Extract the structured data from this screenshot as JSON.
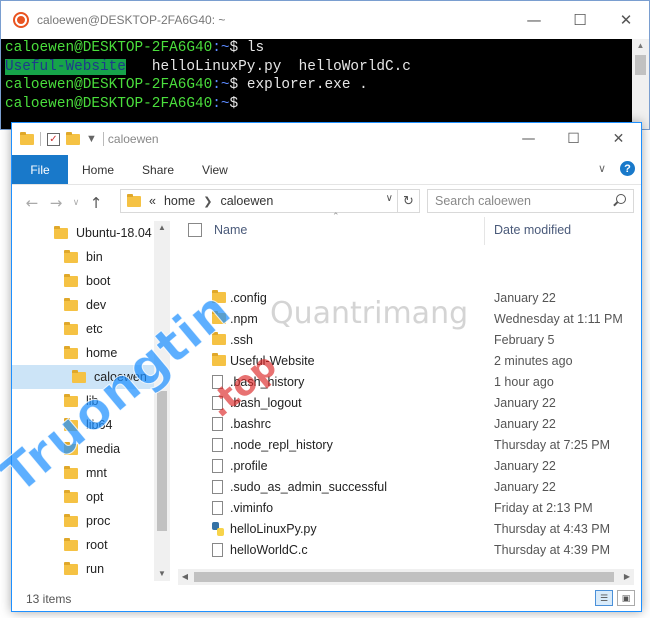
{
  "terminal": {
    "title": "caloewen@DESKTOP-2FA6G40: ~",
    "user_host": "caloewen@DESKTOP-2FA6G40",
    "path": ":~",
    "prompt_char": "$",
    "lines": [
      {
        "cmd": " ls"
      },
      {
        "cmd": " explorer.exe ."
      },
      {
        "cmd": ""
      }
    ],
    "ls_output": {
      "dir": "Useful-Website",
      "files": "   helloLinuxPy.py  helloWorldC.c"
    }
  },
  "explorer": {
    "title": "caloewen",
    "ribbon_tabs": [
      "File",
      "Home",
      "Share",
      "View"
    ],
    "breadcrumb": {
      "lead": "«",
      "items": [
        "home",
        "caloewen"
      ]
    },
    "search_placeholder": "Search caloewen",
    "nav_items": [
      {
        "label": "Ubuntu-18.04"
      },
      {
        "label": "bin"
      },
      {
        "label": "boot"
      },
      {
        "label": "dev"
      },
      {
        "label": "etc"
      },
      {
        "label": "home"
      },
      {
        "label": "caloewen"
      },
      {
        "label": "lib"
      },
      {
        "label": "lib64"
      },
      {
        "label": "media"
      },
      {
        "label": "mnt"
      },
      {
        "label": "opt"
      },
      {
        "label": "proc"
      },
      {
        "label": "root"
      },
      {
        "label": "run"
      }
    ],
    "columns": {
      "name": "Name",
      "date": "Date modified"
    },
    "files": [
      {
        "name": ".config",
        "date": "January 22",
        "icon": "folder-icon"
      },
      {
        "name": ".npm",
        "date": "Wednesday at 1:11 PM",
        "icon": "folder-icon"
      },
      {
        "name": ".ssh",
        "date": "February 5",
        "icon": "folder-icon"
      },
      {
        "name": "Useful-Website",
        "date": "2 minutes ago",
        "icon": "folder-icon"
      },
      {
        "name": ".bash_history",
        "date": "1 hour ago",
        "icon": "file-icon"
      },
      {
        "name": ".bash_logout",
        "date": "January 22",
        "icon": "file-icon"
      },
      {
        "name": ".bashrc",
        "date": "January 22",
        "icon": "file-icon"
      },
      {
        "name": ".node_repl_history",
        "date": "Thursday at 7:25 PM",
        "icon": "file-icon"
      },
      {
        "name": ".profile",
        "date": "January 22",
        "icon": "file-icon"
      },
      {
        "name": ".sudo_as_admin_successful",
        "date": "January 22",
        "icon": "file-icon"
      },
      {
        "name": ".viminfo",
        "date": "Friday at 2:13 PM",
        "icon": "file-icon"
      },
      {
        "name": "helloLinuxPy.py",
        "date": "Thursday at 4:43 PM",
        "icon": "python-file-icon"
      },
      {
        "name": "helloWorldC.c",
        "date": "Thursday at 4:39 PM",
        "icon": "file-icon"
      }
    ],
    "status": "13 items"
  },
  "watermarks": {
    "main": "Truongtin",
    "top": ".top",
    "overlay": "Quantrimang"
  },
  "colors": {
    "terminal_bg": "#000000",
    "prompt_user": "#4ade3c",
    "prompt_path": "#5c8aff",
    "ribbon_file": "#1979ca",
    "selection": "#cce4f7"
  }
}
